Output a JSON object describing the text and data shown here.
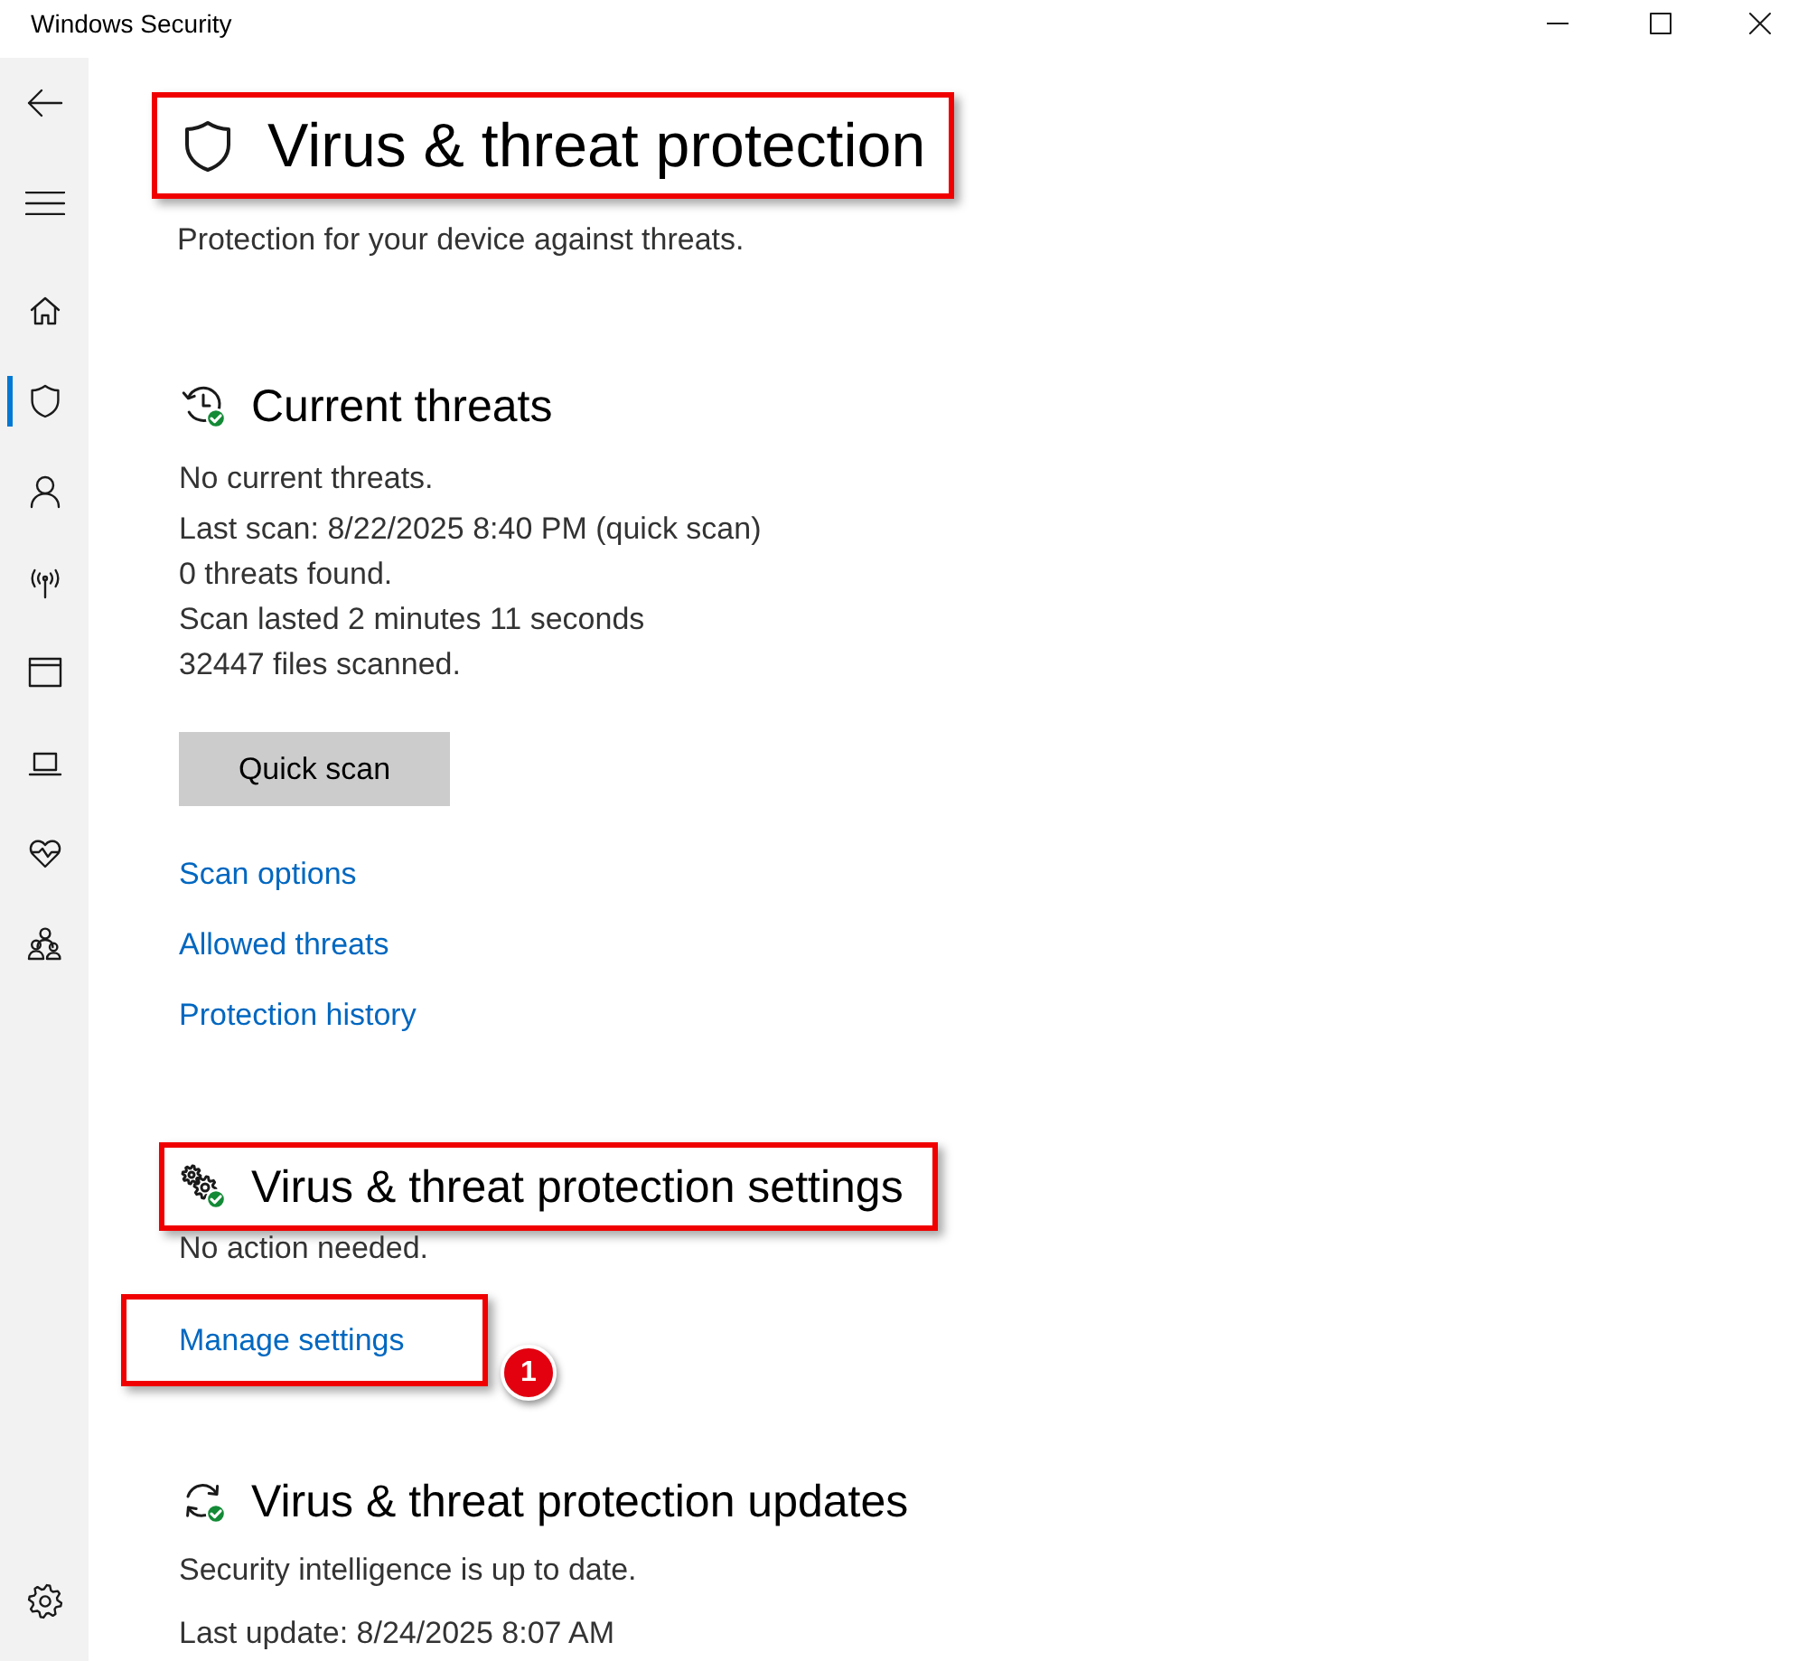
{
  "window": {
    "title": "Windows Security"
  },
  "sidebar": {
    "nav_items": [
      {
        "selected": false
      },
      {
        "selected": true
      },
      {
        "selected": false
      },
      {
        "selected": false
      },
      {
        "selected": false
      },
      {
        "selected": false
      },
      {
        "selected": false
      },
      {
        "selected": false
      }
    ]
  },
  "page": {
    "title": "Virus & threat protection",
    "highlighted": true,
    "subtitle": "Protection for your device against threats."
  },
  "sections": [
    {
      "kind": "threats",
      "title": "Current threats",
      "highlighted": false,
      "status": "No current threats.",
      "details": [
        "Last scan: 8/22/2025 8:40 PM (quick scan)",
        "0 threats found.",
        "Scan lasted 2 minutes 11 seconds",
        "32447 files scanned."
      ],
      "button": "Quick scan",
      "links": [
        {
          "label": "Scan options",
          "highlighted": false
        },
        {
          "label": "Allowed threats",
          "highlighted": false
        },
        {
          "label": "Protection history",
          "highlighted": false
        }
      ]
    },
    {
      "kind": "settings",
      "title": "Virus & threat protection settings",
      "highlighted": true,
      "status": "No action needed.",
      "links": [
        {
          "label": "Manage settings",
          "highlighted": true,
          "callout": "1"
        }
      ]
    },
    {
      "kind": "updates",
      "title": "Virus & threat protection updates",
      "highlighted": false,
      "status": "Security intelligence is up to date.",
      "details": [
        "Last update: 8/24/2025 8:07 AM"
      ]
    }
  ]
}
